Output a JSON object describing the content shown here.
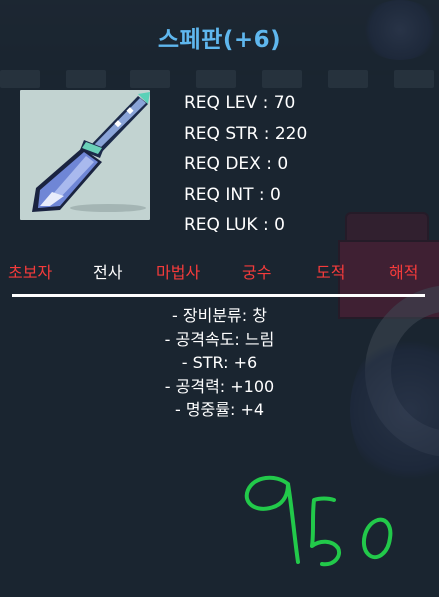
{
  "item": {
    "title": "스페판(+6)",
    "icon": "spear-icon"
  },
  "requirements": [
    {
      "label": "REQ LEV : 70"
    },
    {
      "label": "REQ STR : 220"
    },
    {
      "label": "REQ DEX : 0"
    },
    {
      "label": "REQ INT : 0"
    },
    {
      "label": "REQ LUK : 0"
    }
  ],
  "jobs": [
    {
      "label": "초보자",
      "active": false
    },
    {
      "label": "전사",
      "active": true
    },
    {
      "label": "마법사",
      "active": false
    },
    {
      "label": "궁수",
      "active": false
    },
    {
      "label": "도적",
      "active": false
    },
    {
      "label": "해적",
      "active": false
    }
  ],
  "stats": [
    "- 장비분류: 창",
    "- 공격속도: 느림",
    "- STR: +6",
    "- 공격력: +100",
    "- 명중률: +4"
  ],
  "handwritten_price": "950",
  "colors": {
    "title": "#5fb7ee",
    "job_unavailable": "#f43b3b",
    "job_available": "#ffffff",
    "handwriting": "#22c94a"
  }
}
